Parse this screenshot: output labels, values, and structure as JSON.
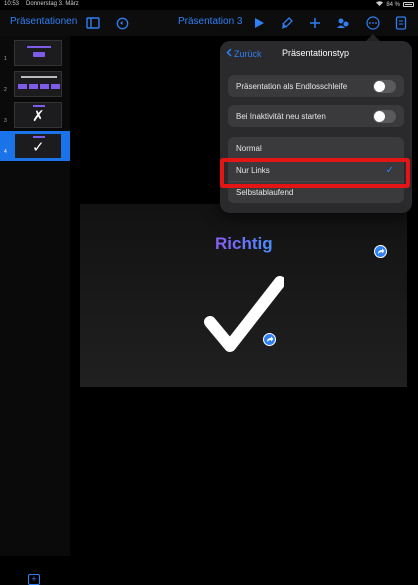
{
  "status_bar": {
    "time": "10:53",
    "date": "Donnerstag 3. März",
    "battery": "84 %"
  },
  "toolbar": {
    "back_label": "Präsentationen",
    "document_title": "Präsentation 3"
  },
  "sidebar": {
    "slides": [
      {
        "number": "1"
      },
      {
        "number": "2"
      },
      {
        "number": "3"
      },
      {
        "number": "4"
      }
    ],
    "thumb_3_glyph": "✗",
    "thumb_4_glyph": "✓"
  },
  "slide": {
    "title": "Richtig",
    "checkmark_glyph": "✓"
  },
  "popover": {
    "back_label": "Zurück",
    "title": "Präsentationstyp",
    "toggles": [
      {
        "label": "Präsentation als Endlosschleife",
        "on": false
      },
      {
        "label": "Bei Inaktivität neu starten",
        "on": false
      }
    ],
    "options": [
      {
        "label": "Normal",
        "selected": false
      },
      {
        "label": "Nur Links",
        "selected": true
      },
      {
        "label": "Selbstablaufend",
        "selected": false
      }
    ],
    "checkmark": "✓"
  },
  "colors": {
    "accent": "#2f7ff5",
    "highlight": "#e51515",
    "selected_slide": "#1a73e8"
  }
}
